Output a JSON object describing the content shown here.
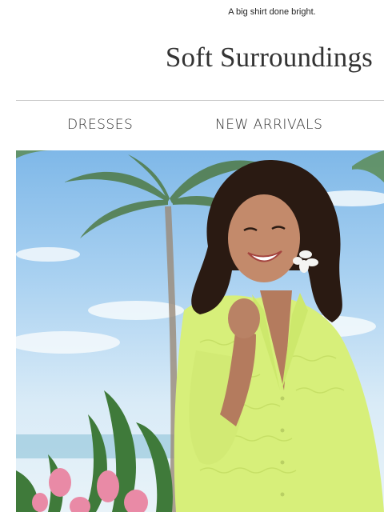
{
  "preheader": {
    "text": "A big shirt done bright."
  },
  "header": {
    "logo": "Soft Surroundings"
  },
  "nav": {
    "items": [
      {
        "label": "DRESSES"
      },
      {
        "label": "NEW ARRIVALS"
      }
    ]
  },
  "hero": {
    "image": "photo of a smiling woman with curly hair in a lime green textured button shirt, palm trees and pink flowers behind",
    "colors": {
      "shirt": "#d7ef7a",
      "sky": "#a9d1f1",
      "hair": "#2a1a12"
    }
  }
}
